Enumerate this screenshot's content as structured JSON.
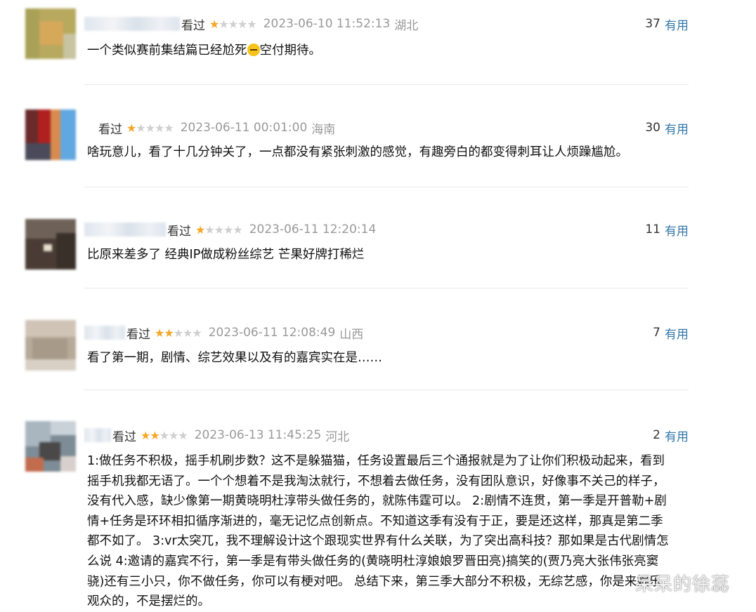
{
  "watched_label": "看过",
  "helpful_label": "有用",
  "star_glyph": "★",
  "comments": [
    {
      "stars": 1,
      "time": "2023-06-10 11:52:13",
      "location": "湖北",
      "votes": "37",
      "text_a": "一个类似赛前集结篇已经尬死",
      "emoji": "expressionless-emoji",
      "text_b": "空付期待。"
    },
    {
      "stars": 1,
      "time": "2023-06-11 00:01:00",
      "location": "海南",
      "votes": "30",
      "text": "啥玩意儿，看了十几分钟关了，一点都没有紧张刺激的感觉，有趣旁白的都变得刺耳让人烦躁尴尬。"
    },
    {
      "stars": 1,
      "time": "2023-06-11 12:20:14",
      "location": "",
      "votes": "11",
      "text": "比原来差多了 经典IP做成粉丝综艺 芒果好牌打稀烂"
    },
    {
      "stars": 2,
      "time": "2023-06-11 12:08:49",
      "location": "山西",
      "votes": "7",
      "text": "看了第一期，剧情、综艺效果以及有的嘉宾实在是……"
    },
    {
      "stars": 2,
      "time": "2023-06-13 11:45:25",
      "location": "河北",
      "votes": "2",
      "lines": [
        "1:做任务不积极，摇手机刷步数？这不是躲猫猫，任务设置最后三个通报就是为了让你们积极动起来，看到",
        "摇手机我都无语了。一个个想着不是我淘汰就行，不想着去做任务，没有团队意识，好像事不关己的样子，",
        "没有代入感，缺少像第一期黄晓明杜淳带头做任务的，就陈伟霆可以。 2:剧情不连贯，第一季是开普勒+剧",
        "情+任务是环环相扣循序渐进的，毫无记忆点创新点。不知道这季有没有于正，要是还这样，那真是第二季",
        "都不如了。 3:vr太突兀，我不理解设计这个跟现实世界有什么关联，为了突出高科技？那如果是古代剧情怎",
        "么说 4:邀请的嘉宾不行，第一季是有带头做任务的(黄晓明杜淳娘娘罗晋田亮)搞笑的(贾乃亮大张伟张亮窦",
        "骁)还有三小只，你不做任务，你可以有梗对吧。 总结下来，第三季大部分不积极，无综艺感，你是来娱乐",
        "观众的，不是摆烂的。"
      ]
    }
  ],
  "watermark": "呆呆的徐蕊"
}
